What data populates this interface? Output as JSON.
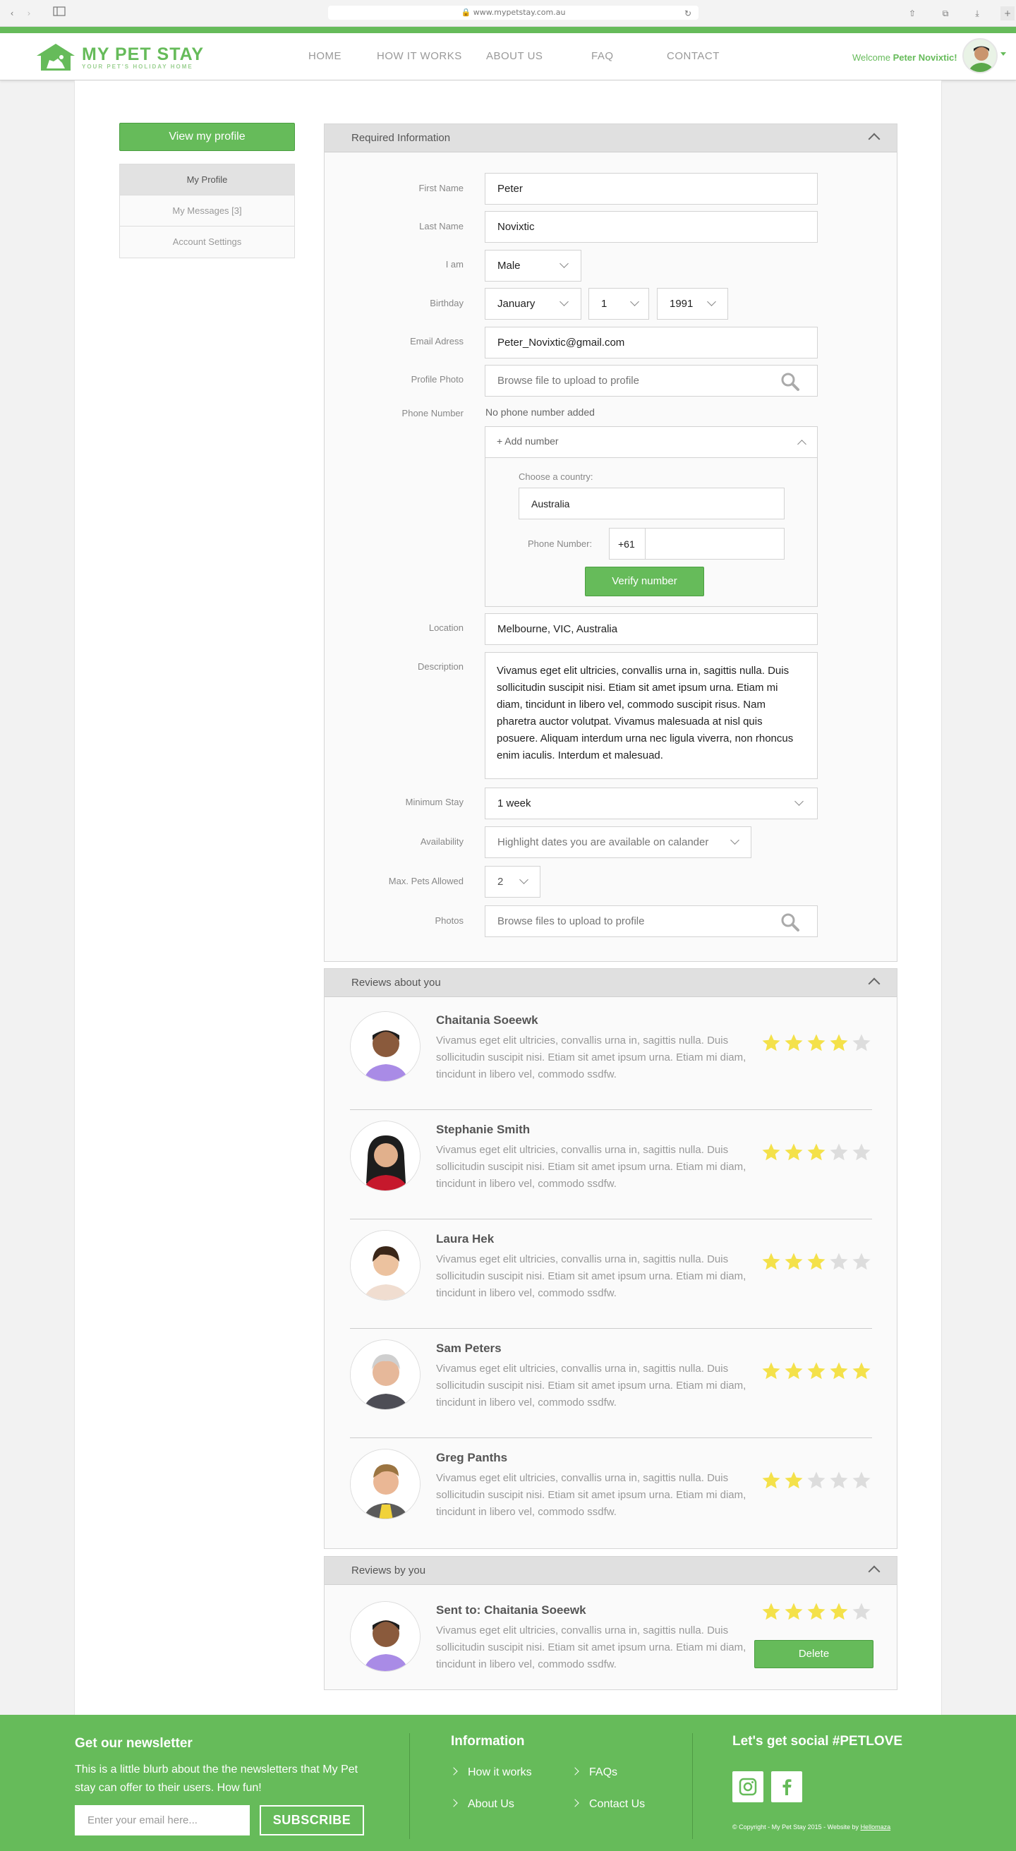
{
  "browser": {
    "url": "www.mypetstay.com.au"
  },
  "brand": {
    "name": "MY PET STAY",
    "tagline": "YOUR PET'S HOLIDAY HOME",
    "accent": "#66bb5a"
  },
  "nav": [
    "HOME",
    "HOW IT WORKS",
    "ABOUT US",
    "FAQ",
    "CONTACT"
  ],
  "user": {
    "welcome": "Welcome",
    "name": "Peter Novixtic!"
  },
  "sidebar": {
    "view_profile": "View my profile",
    "items": [
      "My Profile",
      "My Messages [3]",
      "Account Settings"
    ]
  },
  "required": {
    "title": "Required Information",
    "labels": {
      "first_name": "First Name",
      "last_name": "Last Name",
      "i_am": "I am",
      "birthday": "Birthday",
      "email": "Email Adress",
      "photo": "Profile Photo",
      "phone": "Phone Number",
      "location": "Location",
      "description": "Description",
      "min_stay": "Minimum Stay",
      "availability": "Availability",
      "max_pets": "Max. Pets Allowed",
      "photos": "Photos"
    },
    "first_name": "Peter",
    "last_name": "Novixtic",
    "gender": "Male",
    "birth_month": "January",
    "birth_day": "1",
    "birth_year": "1991",
    "email": "Peter_Novixtic@gmail.com",
    "photo_placeholder": "Browse file to upload to profile",
    "phone_status": "No phone number added",
    "add_number": "+ Add number",
    "choose_country": "Choose a country:",
    "country": "Australia",
    "phone_label": "Phone Number:",
    "phone_code": "+61",
    "verify": "Verify number",
    "location": "Melbourne, VIC, Australia",
    "description": "Vivamus eget elit ultricies, convallis urna in, sagittis nulla. Duis sollicitudin suscipit nisi. Etiam sit amet ipsum urna. Etiam mi diam, tincidunt in libero vel, commodo suscipit risus. Nam pharetra auctor volutpat. Vivamus malesuada at nisl quis posuere. Aliquam interdum urna nec ligula viverra, non rhoncus enim iaculis. Interdum et malesuad.",
    "min_stay": "1 week",
    "availability_placeholder": "Highlight dates you are available on calander",
    "max_pets": "2",
    "photos_placeholder": "Browse files to upload to profile"
  },
  "reviews_about": {
    "title": "Reviews about you",
    "items": [
      {
        "name": "Chaitania Soeewk",
        "text": "Vivamus eget elit ultricies, convallis urna in, sagittis nulla. Duis sollicitudin suscipit nisi. Etiam sit amet ipsum urna. Etiam mi diam, tincidunt in libero vel, commodo ssdfw.",
        "rating": 4
      },
      {
        "name": "Stephanie Smith",
        "text": "Vivamus eget elit ultricies, convallis urna in, sagittis nulla. Duis sollicitudin suscipit nisi. Etiam sit amet ipsum urna. Etiam mi diam, tincidunt in libero vel, commodo ssdfw.",
        "rating": 3
      },
      {
        "name": "Laura Hek",
        "text": "Vivamus eget elit ultricies, convallis urna in, sagittis nulla. Duis sollicitudin suscipit nisi. Etiam sit amet ipsum urna. Etiam mi diam, tincidunt in libero vel, commodo ssdfw.",
        "rating": 3
      },
      {
        "name": "Sam Peters",
        "text": "Vivamus eget elit ultricies, convallis urna in, sagittis nulla. Duis sollicitudin suscipit nisi. Etiam sit amet ipsum urna. Etiam mi diam, tincidunt in libero vel, commodo ssdfw.",
        "rating": 5
      },
      {
        "name": "Greg Panths",
        "text": "Vivamus eget elit ultricies, convallis urna in, sagittis nulla. Duis sollicitudin suscipit nisi. Etiam sit amet ipsum urna. Etiam mi diam, tincidunt in libero vel, commodo ssdfw.",
        "rating": 2
      }
    ]
  },
  "reviews_by": {
    "title": "Reviews by you",
    "items": [
      {
        "name": "Sent to: Chaitania Soeewk",
        "text": "Vivamus eget elit ultricies, convallis urna in, sagittis nulla. Duis sollicitudin suscipit nisi. Etiam sit amet ipsum urna. Etiam mi diam, tincidunt in libero vel, commodo ssdfw.",
        "rating": 4
      }
    ],
    "delete": "Delete"
  },
  "footer": {
    "newsletter_title": "Get our newsletter",
    "newsletter_blurb": "This is a little blurb about the the newsletters that My Pet stay can offer to their users. How fun!",
    "email_placeholder": "Enter your email here...",
    "subscribe": "SUBSCRIBE",
    "info_title": "Information",
    "links": [
      "How it works",
      "FAQs",
      "About Us",
      "Contact Us"
    ],
    "social_title": "Let's get social #PETLOVE",
    "copyright": "© Copyright - My Pet Stay 2015 - Website by",
    "credit": "Hellomaza"
  },
  "colors": {
    "star_on": "#f4e14a",
    "star_off": "#dddddd"
  }
}
